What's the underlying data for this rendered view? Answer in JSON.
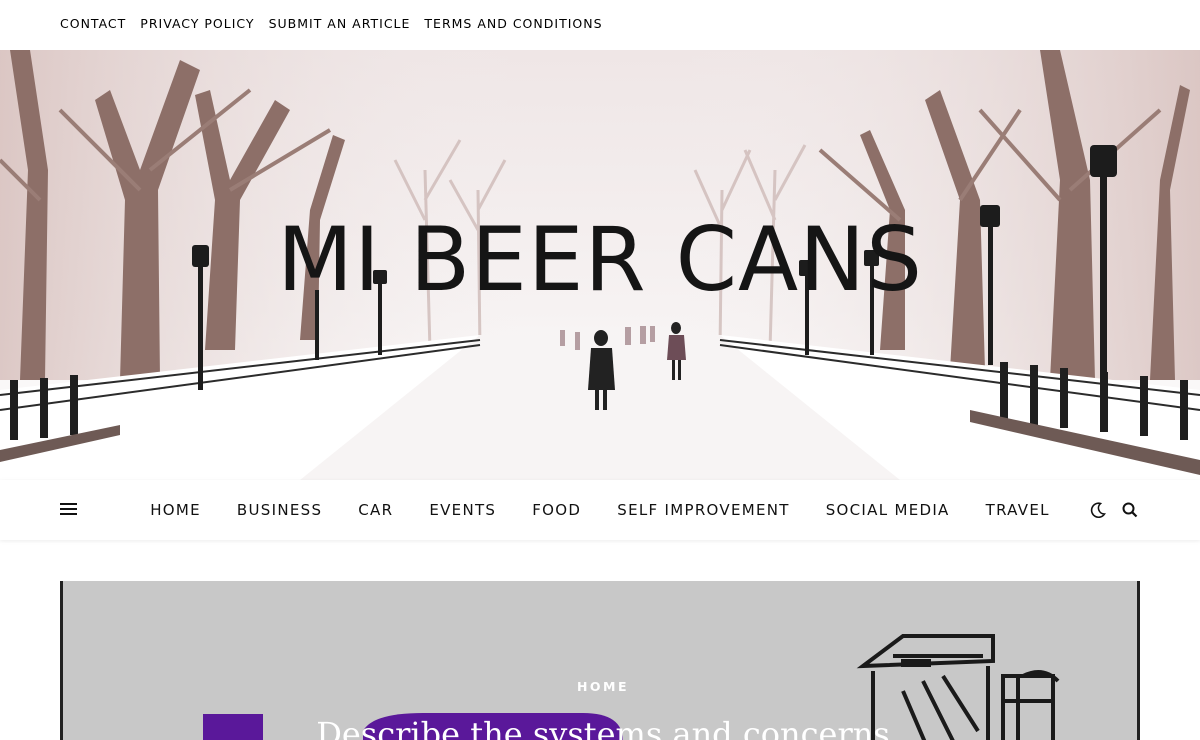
{
  "top_menu": {
    "items": [
      "CONTACT",
      "PRIVACY POLICY",
      "SUBMIT AN ARTICLE",
      "TERMS AND CONDITIONS"
    ]
  },
  "header": {
    "site_title": "MI BEER CANS"
  },
  "main_nav": {
    "items": [
      "HOME",
      "BUSINESS",
      "CAR",
      "EVENTS",
      "FOOD",
      "SELF IMPROVEMENT",
      "SOCIAL MEDIA",
      "TRAVEL"
    ],
    "icons": [
      "menu-icon",
      "dark-mode-moon-icon",
      "search-icon"
    ]
  },
  "featured_post": {
    "category": "HOME",
    "title": "Describe the systems and concerns"
  },
  "colors": {
    "title_text": "#151515",
    "featured_background": "#c8c8c8",
    "accent_purple": "#5a189a"
  }
}
